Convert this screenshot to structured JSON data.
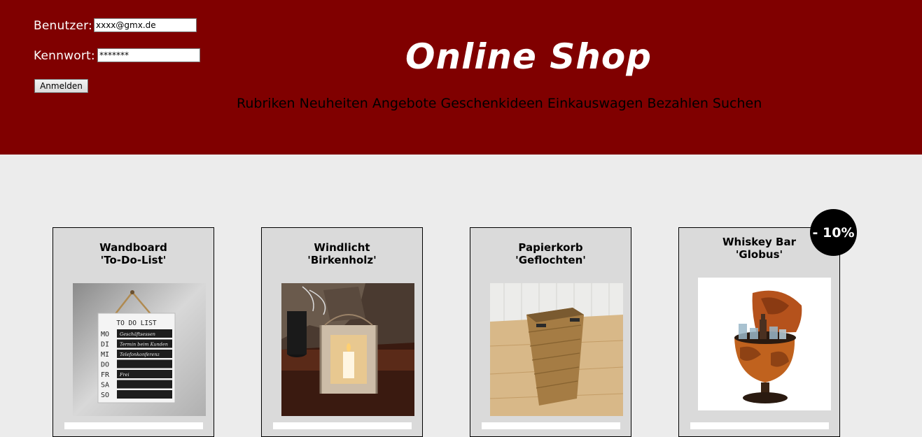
{
  "login": {
    "user_label": "Benutzer:",
    "user_value": "xxxx@gmx.de",
    "password_label": "Kennwort:",
    "password_value": "*******",
    "button_label": "Anmelden"
  },
  "header": {
    "title": "Online Shop",
    "nav": [
      "Rubriken",
      "Neuheiten",
      "Angebote",
      "Geschenkideen",
      "Einkauswagen",
      "Bezahlen",
      "Suchen"
    ]
  },
  "products": [
    {
      "line1": "Wandboard",
      "line2": "'To-Do-List'"
    },
    {
      "line1": "Windlicht",
      "line2": "'Birkenholz'"
    },
    {
      "line1": "Papierkorb",
      "line2": "'Geflochten'"
    },
    {
      "line1": "Whiskey Bar",
      "line2": "'Globus'",
      "badge": "- 10%"
    }
  ],
  "todo_board": {
    "heading": "TO DO LIST",
    "days": [
      "MO",
      "DI",
      "MI",
      "DO",
      "FR",
      "SA",
      "SO"
    ],
    "entries": [
      "Geschäftsessen",
      "Termin beim Kunden",
      "Telefonkonferenz",
      "",
      "Frei",
      "",
      ""
    ]
  },
  "colors": {
    "header": "#800000",
    "background": "#ececec",
    "card": "#dadada",
    "badge": "#000000"
  }
}
